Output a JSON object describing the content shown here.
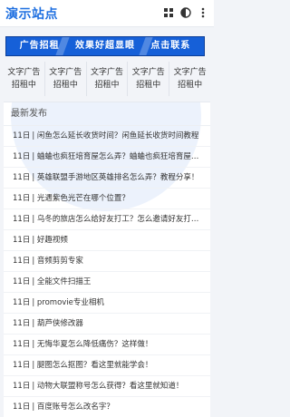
{
  "header": {
    "logo": "演示站点",
    "icons": [
      "grid-icon",
      "contrast-icon",
      "more-icon"
    ]
  },
  "ad_banner": {
    "words": [
      "广告招租",
      "效果好超显眼",
      "点击联系"
    ]
  },
  "ad_grid": {
    "cells": [
      "文字广告招租中",
      "文字广告招租中",
      "文字广告招租中",
      "文字广告招租中",
      "文字广告招租中"
    ]
  },
  "latest": {
    "title": "最新发布",
    "items": [
      {
        "date": "11日",
        "text": "闲鱼怎么延长收货时间？闲鱼延长收货时间教程"
      },
      {
        "date": "11日",
        "text": "蛐蛐也疯狂培育屋怎么弄？蛐蛐也疯狂培育屋玩法"
      },
      {
        "date": "11日",
        "text": "英雄联盟手游地区英雄排名怎么弄？教程分享！"
      },
      {
        "date": "11日",
        "text": "光遇紫色光芒在哪个位置？"
      },
      {
        "date": "11日",
        "text": "乌冬的旅店怎么给好友打工？怎么邀请好友打工？"
      },
      {
        "date": "11日",
        "text": "好趣视频"
      },
      {
        "date": "11日",
        "text": "音频剪剪专家"
      },
      {
        "date": "11日",
        "text": "全能文件扫描王"
      },
      {
        "date": "11日",
        "text": "promovie专业相机"
      },
      {
        "date": "11日",
        "text": "葫芦侠修改器"
      },
      {
        "date": "11日",
        "text": "无悔华夏怎么降低痛伤？这样做！"
      },
      {
        "date": "11日",
        "text": "腿图怎么抠图？看这里就能学会！"
      },
      {
        "date": "11日",
        "text": "动物大联盟称号怎么获得？看这里就知道！"
      },
      {
        "date": "11日",
        "text": "百度账号怎么改名字？"
      }
    ]
  },
  "colors": {
    "brand": "#1e6fe0",
    "ad_bg": "#1660d8",
    "page_bg": "#f2f4f8"
  }
}
